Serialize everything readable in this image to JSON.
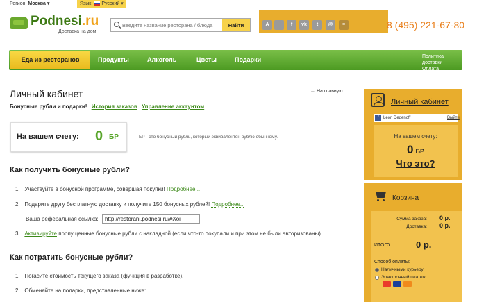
{
  "topbar": {
    "region_label": "Регион:",
    "region_value": "Москва ▾",
    "lang_label": "Язык:",
    "lang_value": "Русский ▾"
  },
  "logo": {
    "brand": "Podnesi",
    "domain": ".ru",
    "tagline": "Доставка на дом"
  },
  "search": {
    "placeholder": "Введите название ресторана / блюда",
    "button": "Найти"
  },
  "social": [
    "android",
    "apple",
    "f",
    "vk",
    "twitter",
    "mail",
    "forum"
  ],
  "phone": "8 (495) 221-67-80",
  "nav": {
    "active": "Еда из ресторанов",
    "items": [
      "Продукты",
      "Алкоголь",
      "Цветы",
      "Подарки"
    ],
    "right_line1": "Политика доставки",
    "right_line2": "Оплата"
  },
  "main": {
    "title": "Личный кабинет",
    "back": "← На главную",
    "tab_current": "Бонусные рубли и подарки!",
    "tab_history": "История заказов",
    "tab_account": "Управление аккаунтом",
    "balance_label": "На вашем счету:",
    "balance_value": "0",
    "balance_currency": "БР",
    "balance_note": "БР - это бонусный рубль, который эквивалентен рублю обычному.",
    "how_get_title": "Как получить бонусные рубли?",
    "get1_num": "1.",
    "get1_text": "Участвуйте в бонусной программе, совершая покупки!",
    "get1_more": "Подробнее...",
    "get2_num": "2.",
    "get2_text": "Подарите другу бесплатную доставку и получите 150 бонусных рублей!",
    "get2_more": "Подробнее...",
    "ref_label": "Ваша реферальная ссылка:",
    "ref_value": "http://restorani.podnesi.ru/#Xoi",
    "get3_num": "3.",
    "get3_link": "Активируйте",
    "get3_text": "пропущенные бонусные рубли с накладной (если что-то покупали и при этом не были авторизованы).",
    "how_spend_title": "Как потратить бонусные рубли?",
    "spend1_num": "1.",
    "spend1_text": "Погасите стоимость текущего заказа (функция в разработке).",
    "spend2_num": "2.",
    "spend2_text": "Обменяйте на подарки, представленные ниже:"
  },
  "account_panel": {
    "title": "Личный кабинет",
    "user": "Leon Dedenoff",
    "exit": "Выйти",
    "balance_label": "На вашем счету:",
    "balance_value": "0",
    "balance_currency": "БР",
    "what_link": "Что это?"
  },
  "cart_panel": {
    "title": "Корзина",
    "sum_label": "Сумма заказа:",
    "sum_value": "0 р.",
    "delivery_label": "Доставка:",
    "delivery_value": "0 р.",
    "total_label": "ИТОГО:",
    "total_value": "0 р.",
    "payment_label": "Способ оплаты:",
    "payment_opt1": "Наличными курьеру",
    "payment_opt2": "Электронный платеж"
  }
}
